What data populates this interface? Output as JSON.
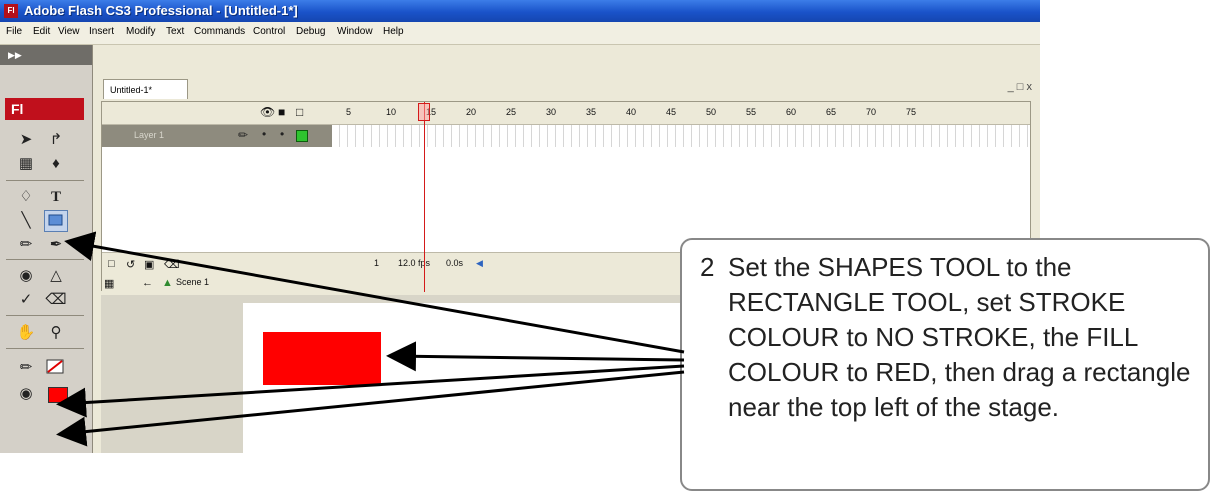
{
  "window": {
    "title": "Adobe Flash CS3 Professional - [Untitled-1*]",
    "app_icon_text": "Fl"
  },
  "menubar": {
    "items": [
      "File",
      "Edit",
      "View",
      "Insert",
      "Modify",
      "Text",
      "Commands",
      "Control",
      "Debug",
      "Window",
      "Help"
    ]
  },
  "tools": {
    "badge": "Fl",
    "text_tool_glyph": "T"
  },
  "document": {
    "tab_label": "Untitled-1*",
    "window_controls": "_ □ x"
  },
  "timeline": {
    "frame_numbers": [
      "5",
      "10",
      "15",
      "20",
      "25",
      "30",
      "35",
      "40",
      "45",
      "50",
      "55",
      "60",
      "65",
      "70",
      "75"
    ],
    "layer_name": "Layer 1",
    "current_frame": "1",
    "frame_rate": "12.0 fps",
    "elapsed": "0.0s",
    "scene_label": "Scene 1"
  },
  "stage": {
    "rectangle_fill": "#ff0000"
  },
  "callout": {
    "number": "2",
    "text": "Set the SHAPES TOOL to the RECTANGLE TOOL, set STROKE COLOUR to NO STROKE, the FILL COLOUR to RED,  then drag a rectangle near the top left of the stage."
  },
  "colors": {
    "titlebar": "#1a53c9",
    "flash_red": "#c0101c",
    "playhead": "#d41a1a"
  }
}
